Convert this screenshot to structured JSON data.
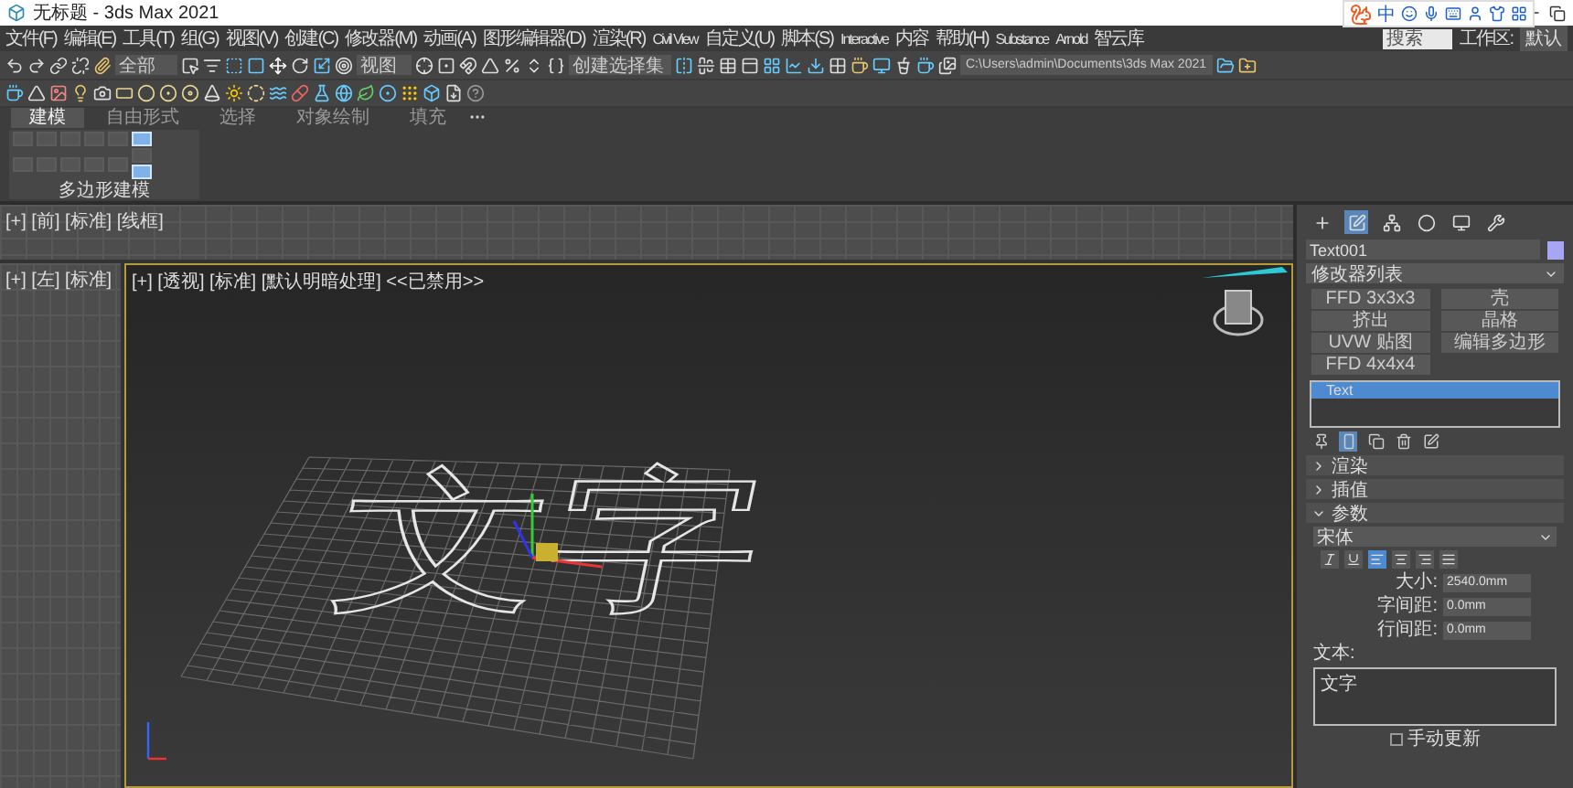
{
  "window": {
    "title": "无标题 - 3ds Max 2021"
  },
  "ime_bar": {
    "label": "中"
  },
  "menu": [
    "文件(F)",
    "编辑(E)",
    "工具(T)",
    "组(G)",
    "视图(V)",
    "创建(C)",
    "修改器(M)",
    "动画(A)",
    "图形编辑器(D)",
    "渲染(R)",
    "Civil View",
    "自定义(U)",
    "脚本(S)",
    "Interactive",
    "内容",
    "帮助(H)",
    "Substance",
    "Arnold",
    "智云库"
  ],
  "search": {
    "placeholder": "搜索"
  },
  "workspace": {
    "label": "工作区:",
    "value": "默认"
  },
  "toolbar": {
    "filter": "全部",
    "coord": "视图",
    "selection_set": "创建选择集",
    "project_path": "C:\\Users\\admin\\Documents\\3ds Max 2021"
  },
  "ribbon": {
    "tabs": [
      {
        "label": "建模",
        "selected": true
      },
      {
        "label": "自由形式",
        "selected": false
      },
      {
        "label": "选择",
        "selected": false
      },
      {
        "label": "对象绘制",
        "selected": false
      },
      {
        "label": "填充",
        "selected": false
      }
    ],
    "tools": [
      {
        "selected": true
      },
      {
        "selected": false
      },
      {
        "selected": true
      }
    ],
    "panel_label": "多边形建模"
  },
  "viewports": {
    "front": "[+] [前] [标准] [线框]",
    "left": "[+] [左] [标准]",
    "perspective": "[+] [透视] [标准] [默认明暗处理] <<已禁用>>",
    "object_text": "文字"
  },
  "command_panel": {
    "tabs": [
      {
        "kind": "create",
        "selected": false
      },
      {
        "kind": "modify",
        "selected": true
      },
      {
        "kind": "hierarchy",
        "selected": false
      },
      {
        "kind": "motion",
        "selected": false
      },
      {
        "kind": "display",
        "selected": false
      },
      {
        "kind": "utilities",
        "selected": false
      }
    ],
    "object_name": "Text001",
    "modifier_list": "修改器列表",
    "modifier_buttons": [
      "FFD 3x3x3",
      "壳",
      "挤出",
      "晶格",
      "UVW 贴图",
      "编辑多边形",
      "FFD 4x4x4"
    ],
    "stack": [
      {
        "label": "Text",
        "selected": true
      }
    ],
    "stack_tools": [
      {
        "kind": "pin",
        "selected": false
      },
      {
        "kind": "result",
        "selected": true
      },
      {
        "kind": "unique",
        "selected": false
      },
      {
        "kind": "remove",
        "selected": false
      },
      {
        "kind": "configure",
        "selected": false
      }
    ],
    "rollouts": [
      {
        "label": "渲染",
        "expanded": false
      },
      {
        "label": "插值",
        "expanded": false
      },
      {
        "label": "参数",
        "expanded": true
      }
    ],
    "font": "宋体",
    "style_buttons": [
      {
        "kind": "italic",
        "selected": false
      },
      {
        "kind": "underline",
        "selected": false
      },
      {
        "kind": "left",
        "selected": true
      },
      {
        "kind": "center",
        "selected": false
      },
      {
        "kind": "right",
        "selected": false
      },
      {
        "kind": "justify",
        "selected": false
      }
    ],
    "params": [
      {
        "label": "大小:",
        "value": "2540.0mm"
      },
      {
        "label": "字间距:",
        "value": "0.0mm"
      },
      {
        "label": "行间距:",
        "value": "0.0mm"
      }
    ],
    "text_label": "文本:",
    "text_value": "文字",
    "manual_update": {
      "label": "手动更新",
      "checked": false
    }
  }
}
